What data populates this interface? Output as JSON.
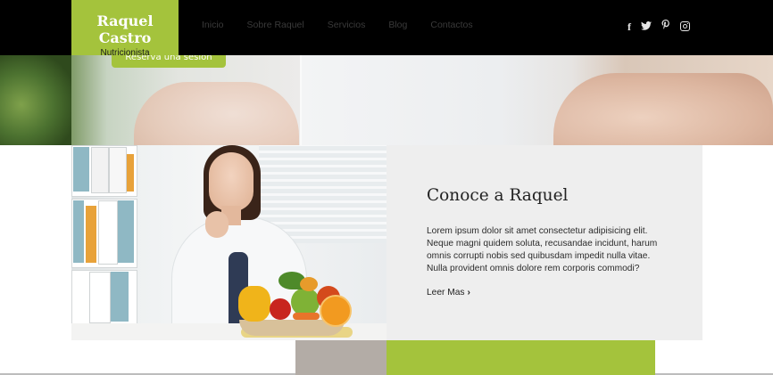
{
  "brand": {
    "name": "Raquel Castro",
    "subtitle": "Nutricionista",
    "accent_color": "#a4c33c"
  },
  "nav": {
    "items": [
      "Inicio",
      "Sobre Raquel",
      "Servicios",
      "Blog",
      "Contactos"
    ]
  },
  "social": {
    "icons": [
      "facebook-icon",
      "twitter-icon",
      "pinterest-icon",
      "instagram-icon"
    ]
  },
  "hero": {
    "button_label": "Reserva una sesión"
  },
  "about": {
    "title": "Conoce a Raquel",
    "body": "Lorem ipsum dolor sit amet consectetur adipisicing elit. Neque magni quidem soluta, recusandae incidunt, harum omnis corrupti nobis sed quibusdam impedit nulla vitae. Nulla provident omnis dolore rem corporis commodi?",
    "read_more": "Leer Mas"
  }
}
